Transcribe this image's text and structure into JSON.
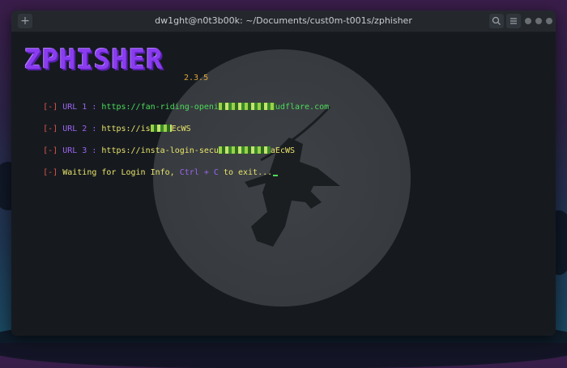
{
  "window": {
    "title": "dw1ght@n0t3b00k: ~/Documents/cust0m-t001s/zphisher",
    "new_tab_glyph": "+",
    "search_icon": "search-icon",
    "menu_icon": "menu-icon"
  },
  "banner": {
    "logo_text": "ZPHISHER",
    "version": "2.3.5"
  },
  "lines": [
    {
      "bracket": "[-]",
      "label": "URL 1 :",
      "prefix": "https://fan-riding-openi",
      "suffix": "udflare.com"
    },
    {
      "bracket": "[-]",
      "label": "URL 2 :",
      "prefix": "https://is",
      "suffix": "EcWS"
    },
    {
      "bracket": "[-]",
      "label": "URL 3 :",
      "prefix": "https://insta-login-secu",
      "suffix": "aEcWS"
    }
  ],
  "waiting": {
    "bracket": "[-]",
    "text_before": "Waiting for Login Info,",
    "shortcut": "Ctrl + C",
    "text_after": "to exit..."
  },
  "colors": {
    "bracket": "#e0564e",
    "label": "#9b63f0",
    "url": "#e9e36a",
    "url_first": "#4ddb5a",
    "logo": "#8a3cf0",
    "version": "#e0a537"
  }
}
